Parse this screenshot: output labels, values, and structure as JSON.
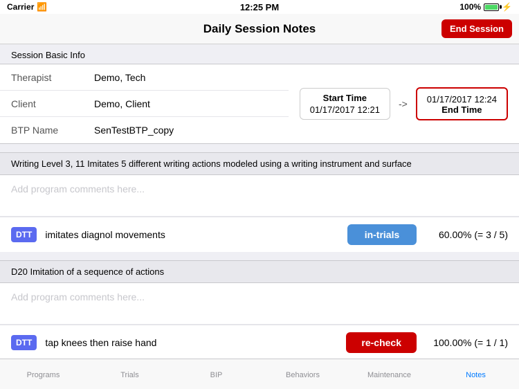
{
  "statusBar": {
    "carrier": "Carrier",
    "wifi": "WiFi",
    "time": "12:25 PM",
    "battery": "100%"
  },
  "navBar": {
    "title": "Daily Session Notes",
    "endSessionLabel": "End Session"
  },
  "sessionInfo": {
    "sectionTitle": "Session Basic Info",
    "fields": [
      {
        "label": "Therapist",
        "value": "Demo, Tech"
      },
      {
        "label": "Client",
        "value": "Demo, Client"
      },
      {
        "label": "BTP Name",
        "value": "SenTestBTP_copy"
      }
    ],
    "startTimeLabel": "Start Time",
    "startTimeValue": "01/17/2017 12:21",
    "arrow": "->",
    "endTimeLabel": "End Time",
    "endTimeValue": "01/17/2017 12:24"
  },
  "programs": [
    {
      "title": "Writing Level 3, 11 Imitates 5 different writing actions modeled using a writing instrument and surface",
      "commentsPlaceholder": "Add program comments here...",
      "trials": [
        {
          "badgeLabel": "DTT",
          "name": "imitates diagnol movements",
          "statusLabel": "in-trials",
          "statusClass": "in-trials",
          "percentage": "60.00% (= 3 / 5)"
        }
      ]
    },
    {
      "title": "D20 Imitation of a sequence of actions",
      "commentsPlaceholder": "Add program comments here...",
      "trials": [
        {
          "badgeLabel": "DTT",
          "name": "tap knees then raise hand",
          "statusLabel": "re-check",
          "statusClass": "re-check",
          "percentage": "100.00% (= 1 / 1)"
        }
      ]
    }
  ],
  "tabBar": {
    "tabs": [
      {
        "label": "Programs",
        "active": false
      },
      {
        "label": "Trials",
        "active": false
      },
      {
        "label": "BIP",
        "active": false
      },
      {
        "label": "Behaviors",
        "active": false
      },
      {
        "label": "Maintenance",
        "active": false
      },
      {
        "label": "Notes",
        "active": true
      }
    ]
  }
}
